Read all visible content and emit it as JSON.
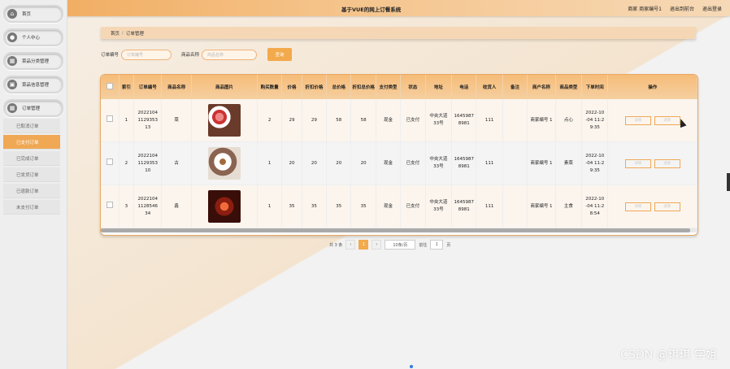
{
  "app": {
    "title": "基于VUE的网上订餐系统"
  },
  "topbar": {
    "user": "商家 商家编号1",
    "back_label": "退出到前台",
    "logout_label": "退出登录"
  },
  "sidebar": {
    "items": [
      {
        "label": "首页",
        "icon": "home-icon"
      },
      {
        "label": "个人中心",
        "icon": "user-icon"
      },
      {
        "label": "菜品分类管理",
        "icon": "grid-icon"
      },
      {
        "label": "菜品信息管理",
        "icon": "bank-icon"
      },
      {
        "label": "订单管理",
        "icon": "grid-icon"
      }
    ],
    "sub_items": [
      {
        "label": "已取消订单",
        "active": false
      },
      {
        "label": "已支付订单",
        "active": true
      },
      {
        "label": "已完成订单",
        "active": false
      },
      {
        "label": "已发货订单",
        "active": false
      },
      {
        "label": "已退款订单",
        "active": false
      },
      {
        "label": "未支付订单",
        "active": false
      }
    ]
  },
  "breadcrumb": {
    "home": "首页",
    "separator": "/",
    "current": "订单管理"
  },
  "search": {
    "order_no_label": "订单编号",
    "order_no_placeholder": "订单编号",
    "dish_name_label": "商品名称",
    "dish_name_placeholder": "商品名称",
    "button": "查询"
  },
  "table": {
    "columns": [
      "索引",
      "订单编号",
      "商品名称",
      "商品图片",
      "购买数量",
      "价格",
      "折扣价格",
      "总价格",
      "折扣总价格",
      "支付类型",
      "状态",
      "地址",
      "电话",
      "收货人",
      "备注",
      "商户名称",
      "商品类型",
      "下单时间",
      "操作"
    ],
    "rows": [
      {
        "index": "1",
        "order_no": "2022104 1129353 13",
        "name": "菜",
        "qty": "2",
        "price": "29",
        "disc_price": "29",
        "total": "58",
        "disc_total": "58",
        "pay": "现金",
        "status": "已支付",
        "address": "中央大道 33号",
        "phone": "1645987 8981",
        "receiver": "111",
        "note": "",
        "merchant": "商家编号 1",
        "type": "点心",
        "time": "2022-10 -04 11:2 9:35"
      },
      {
        "index": "2",
        "order_no": "2022104 1129353 10",
        "name": "古",
        "qty": "1",
        "price": "20",
        "disc_price": "20",
        "total": "20",
        "disc_total": "20",
        "pay": "现金",
        "status": "已支付",
        "address": "中央大道 33号",
        "phone": "1645987 8981",
        "receiver": "111",
        "note": "",
        "merchant": "商家编号 1",
        "type": "素菜",
        "time": "2022-10 -04 11:2 9:35"
      },
      {
        "index": "3",
        "order_no": "2022104 1128546 34",
        "name": "鑫",
        "qty": "1",
        "price": "35",
        "disc_price": "35",
        "total": "35",
        "disc_total": "35",
        "pay": "现金",
        "status": "已支付",
        "address": "中央大道 33号",
        "phone": "1645987 8981",
        "receiver": "111",
        "note": "",
        "merchant": "商家编号 1",
        "type": "主食",
        "time": "2022-10 -04 11:2 8:54"
      }
    ],
    "actions": {
      "detail": "详情",
      "refund": "退款"
    }
  },
  "pager": {
    "total": "共 3 条",
    "current": "1",
    "page_size": "10条/页",
    "goto_label": "前往",
    "goto_value": "1",
    "page_suffix": "页"
  },
  "watermark": "CSDN @琪琪 学姐"
}
